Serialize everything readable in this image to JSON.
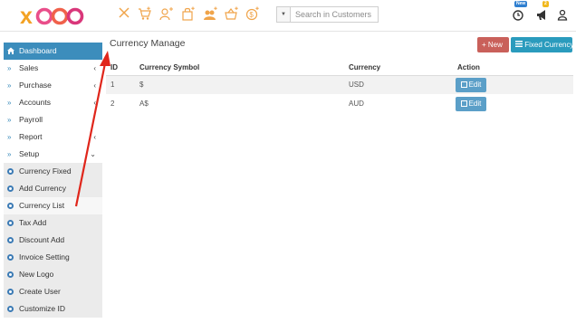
{
  "header": {
    "logo_text": "xaoo",
    "tools": [
      "close-icon",
      "cart-add-icon",
      "user-add-icon",
      "bag-add-icon",
      "users-add-icon",
      "basket-add-icon",
      "money-add-icon"
    ],
    "search": {
      "dropdown_symbol": "▼",
      "placeholder": "Search in Customers"
    },
    "clock_badge": "New",
    "bell_badge": "2"
  },
  "sidebar": {
    "items": [
      {
        "label": "Dashboard",
        "icon": "home-icon",
        "active": true
      },
      {
        "label": "Sales",
        "caret": "‹"
      },
      {
        "label": "Purchase",
        "caret": "‹"
      },
      {
        "label": "Accounts",
        "caret": "‹"
      },
      {
        "label": "Payroll",
        "caret": ""
      },
      {
        "label": "Report",
        "caret": "‹"
      },
      {
        "label": "Setup",
        "caret": "⌄"
      }
    ],
    "sub_items": [
      {
        "label": "Currency Fixed"
      },
      {
        "label": "Add Currency"
      },
      {
        "label": "Currency List"
      },
      {
        "label": "Tax Add"
      },
      {
        "label": "Discount Add"
      },
      {
        "label": "Invoice Setting"
      },
      {
        "label": "New Logo"
      },
      {
        "label": "Create User"
      },
      {
        "label": "Customize ID"
      }
    ]
  },
  "main": {
    "title": "Currency Manage",
    "new_button": "New",
    "new_button_icon": "+",
    "fixed_button": "Fixed Currency",
    "table": {
      "headers": [
        "ID",
        "Currency Symbol",
        "Currency",
        "Action"
      ],
      "rows": [
        {
          "id": "1",
          "symbol": "$",
          "currency": "USD",
          "action": "Edit"
        },
        {
          "id": "2",
          "symbol": "A$",
          "currency": "AUD",
          "action": "Edit"
        }
      ]
    }
  },
  "colors": {
    "accent": "#3c8dbc",
    "new_button": "#c9605a",
    "fixed_button": "#2a9bbd",
    "edit_button": "#5b9fc8",
    "tool_icons": "#f0a44a",
    "annotation_arrow": "#e0261b"
  }
}
